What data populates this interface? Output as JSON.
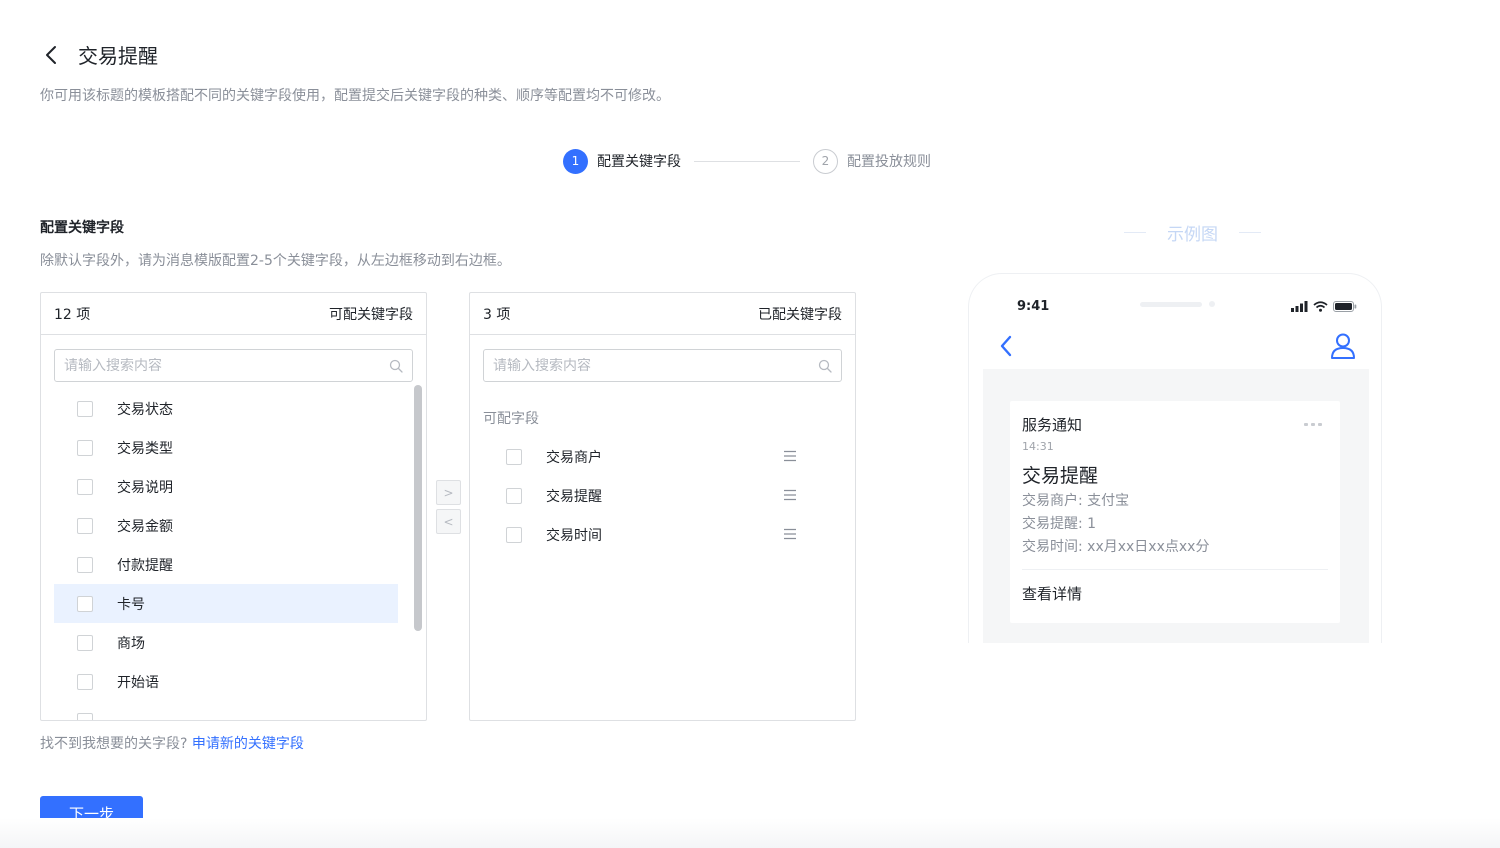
{
  "header": {
    "title": "交易提醒",
    "subtitle": "你可用该标题的模板搭配不同的关键字段使用，配置提交后关键字段的种类、顺序等配置均不可修改。"
  },
  "steps": [
    {
      "number": "1",
      "label": "配置关键字段",
      "active": true
    },
    {
      "number": "2",
      "label": "配置投放规则",
      "active": false
    }
  ],
  "section": {
    "title": "配置关键字段",
    "description": "除默认字段外，请为消息模版配置2-5个关键字段，从左边框移动到右边框。"
  },
  "left_panel": {
    "count": "12 项",
    "title": "可配关键字段",
    "search_placeholder": "请输入搜索内容",
    "items": [
      {
        "label": "交易状态",
        "selected": false
      },
      {
        "label": "交易类型",
        "selected": false
      },
      {
        "label": "交易说明",
        "selected": false
      },
      {
        "label": "交易金额",
        "selected": false
      },
      {
        "label": "付款提醒",
        "selected": false
      },
      {
        "label": "卡号",
        "selected": true
      },
      {
        "label": "商场",
        "selected": false
      },
      {
        "label": "开始语",
        "selected": false
      }
    ]
  },
  "transfer": {
    "right_arrow": ">",
    "left_arrow": "<"
  },
  "right_panel": {
    "count": "3 项",
    "title": "已配关键字段",
    "search_placeholder": "请输入搜索内容",
    "group_label": "可配字段",
    "items": [
      {
        "label": "交易商户"
      },
      {
        "label": "交易提醒"
      },
      {
        "label": "交易时间"
      }
    ]
  },
  "footer": {
    "hint": "找不到我想要的关字段?",
    "link": "申请新的关键字段",
    "next_label": "下一步"
  },
  "example": {
    "label": "示例图",
    "phone": {
      "time": "9:41",
      "card": {
        "header": "服务通知",
        "time": "14:31",
        "title": "交易提醒",
        "fields": [
          "交易商户: 支付宝",
          "交易提醒: 1",
          "交易时间: xx月xx日xx点xx分"
        ],
        "link": "查看详情"
      }
    }
  },
  "colors": {
    "primary": "#3370ff",
    "selected_row": "#eaf2ff",
    "muted_text": "#8a8f99"
  }
}
